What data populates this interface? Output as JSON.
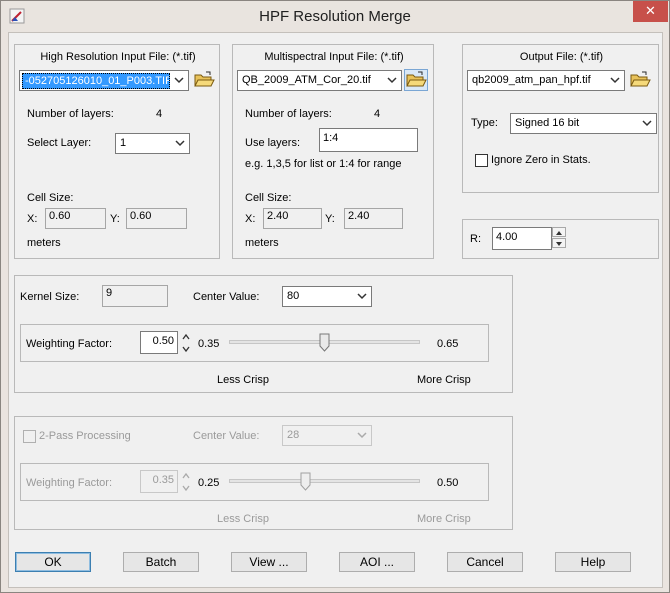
{
  "window": {
    "title": "HPF Resolution Merge",
    "close_glyph": "✕"
  },
  "high_res": {
    "heading": "High Resolution Input File: (*.tif)",
    "file_value": "-052705126010_01_P003.TIF",
    "layers_label": "Number of layers:",
    "layers_value": "4",
    "select_layer_label": "Select Layer:",
    "select_layer_value": "1",
    "cell_size_label": "Cell Size:",
    "x_label": "X:",
    "x_value": "0.60",
    "y_label": "Y:",
    "y_value": "0.60",
    "units": "meters"
  },
  "multispectral": {
    "heading": "Multispectral Input File: (*.tif)",
    "file_value": "QB_2009_ATM_Cor_20.tif",
    "layers_label": "Number of layers:",
    "layers_value": "4",
    "use_layers_label": "Use layers:",
    "use_layers_value": "1:4",
    "hint": "e.g. 1,3,5 for list or 1:4 for range",
    "cell_size_label": "Cell Size:",
    "x_label": "X:",
    "x_value": "2.40",
    "y_label": "Y:",
    "y_value": "2.40",
    "units": "meters"
  },
  "output": {
    "heading": "Output File: (*.tif)",
    "file_value": "qb2009_atm_pan_hpf.tif",
    "type_label": "Type:",
    "type_value": "Signed 16 bit",
    "ignore_zero_label": "Ignore Zero in Stats."
  },
  "r_field": {
    "label": "R:",
    "value": "4.00"
  },
  "kernel": {
    "kernel_label": "Kernel Size:",
    "kernel_value": "9",
    "center_label": "Center Value:",
    "center_value": "80",
    "weight_label": "Weighting Factor:",
    "weight_value": "0.50",
    "slider_min": "0.35",
    "slider_max": "0.65",
    "slider_fraction": 0.5,
    "less_crisp": "Less Crisp",
    "more_crisp": "More Crisp"
  },
  "two_pass": {
    "checkbox_label": "2-Pass Processing",
    "center_label": "Center Value:",
    "center_value": "28",
    "weight_label": "Weighting Factor:",
    "weight_value": "0.35",
    "slider_min": "0.25",
    "slider_max": "0.50",
    "slider_fraction": 0.4,
    "less_crisp": "Less Crisp",
    "more_crisp": "More Crisp"
  },
  "buttons": {
    "ok": "OK",
    "batch": "Batch",
    "view": "View ...",
    "aoi": "AOI ...",
    "cancel": "Cancel",
    "help": "Help"
  },
  "colors": {
    "close_button": "#c7504a",
    "selection": "#3399ff",
    "folder_icon": "#d9a520"
  }
}
